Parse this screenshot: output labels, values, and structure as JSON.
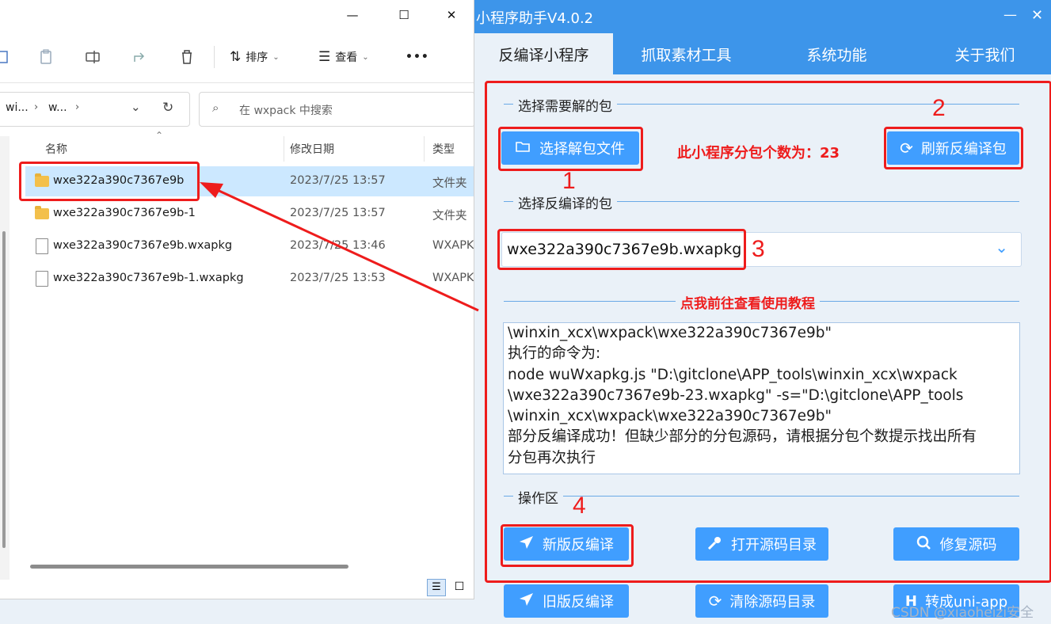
{
  "explorer": {
    "window_controls": {
      "minimize": "—",
      "maximize": "☐",
      "close": "✕"
    },
    "toolbar": {
      "sort_label": "排序",
      "view_label": "查看",
      "more_label": "•••"
    },
    "address": {
      "part1": "wi...",
      "part2": "w...",
      "sep": "›"
    },
    "search": {
      "placeholder": "在 wxpack 中搜索"
    },
    "columns": {
      "name": "名称",
      "date": "修改日期",
      "type": "类型"
    },
    "files": [
      {
        "name": "wxe322a390c7367e9b",
        "date": "2023/7/25 13:57",
        "type": "文件夹",
        "kind": "folder"
      },
      {
        "name": "wxe322a390c7367e9b-1",
        "date": "2023/7/25 13:57",
        "type": "文件夹",
        "kind": "folder"
      },
      {
        "name": "wxe322a390c7367e9b.wxapkg",
        "date": "2023/7/25 13:46",
        "type": "WXAPK",
        "kind": "file"
      },
      {
        "name": "wxe322a390c7367e9b-1.wxapkg",
        "date": "2023/7/25 13:53",
        "type": "WXAPK",
        "kind": "file"
      }
    ]
  },
  "app": {
    "title": "小程序助手V4.0.2",
    "window_controls": {
      "minimize": "—",
      "close": "✕"
    },
    "tabs": [
      "反编译小程序",
      "抓取素材工具",
      "系统功能",
      "关于我们"
    ],
    "section_select_pkg": "选择需要解的包",
    "btn_select_file": "选择解包文件",
    "subpkg_count_text": "此小程序分包个数为：23",
    "btn_refresh": "刷新反编译包",
    "section_select_decompile": "选择反编译的包",
    "selected_pkg": "wxe322a390c7367e9b.wxapkg",
    "tutorial_link": "点我前往查看使用教程",
    "log_lines": [
      "\\winxin_xcx\\wxpack\\wxe322a390c7367e9b\"",
      "执行的命令为:",
      "node wuWxapkg.js \"D:\\gitclone\\APP_tools\\winxin_xcx\\wxpack",
      "\\wxe322a390c7367e9b-23.wxapkg\" -s=\"D:\\gitclone\\APP_tools",
      "\\winxin_xcx\\wxpack\\wxe322a390c7367e9b\"",
      "部分反编译成功！但缺少部分的分包源码，请根据分包个数提示找出所有",
      "分包再次执行"
    ],
    "section_ops": "操作区",
    "btn_new_decompile": "新版反编译",
    "btn_open_src": "打开源码目录",
    "btn_fix_src": "修复源码",
    "btn_old_decompile": "旧版反编译",
    "btn_clear_src": "清除源码目录",
    "btn_to_uniapp": "转成uni-app",
    "btn_to_uniapp_prefix": "H"
  },
  "annotations": {
    "n1": "1",
    "n2": "2",
    "n3": "3",
    "n4": "4"
  },
  "watermark": "CSDN @xiaoheizi安全",
  "colors": {
    "accent": "#409eff",
    "title_bar": "#3d95ea",
    "annotation_red": "#ee1c1c",
    "selection": "#cce8ff"
  }
}
